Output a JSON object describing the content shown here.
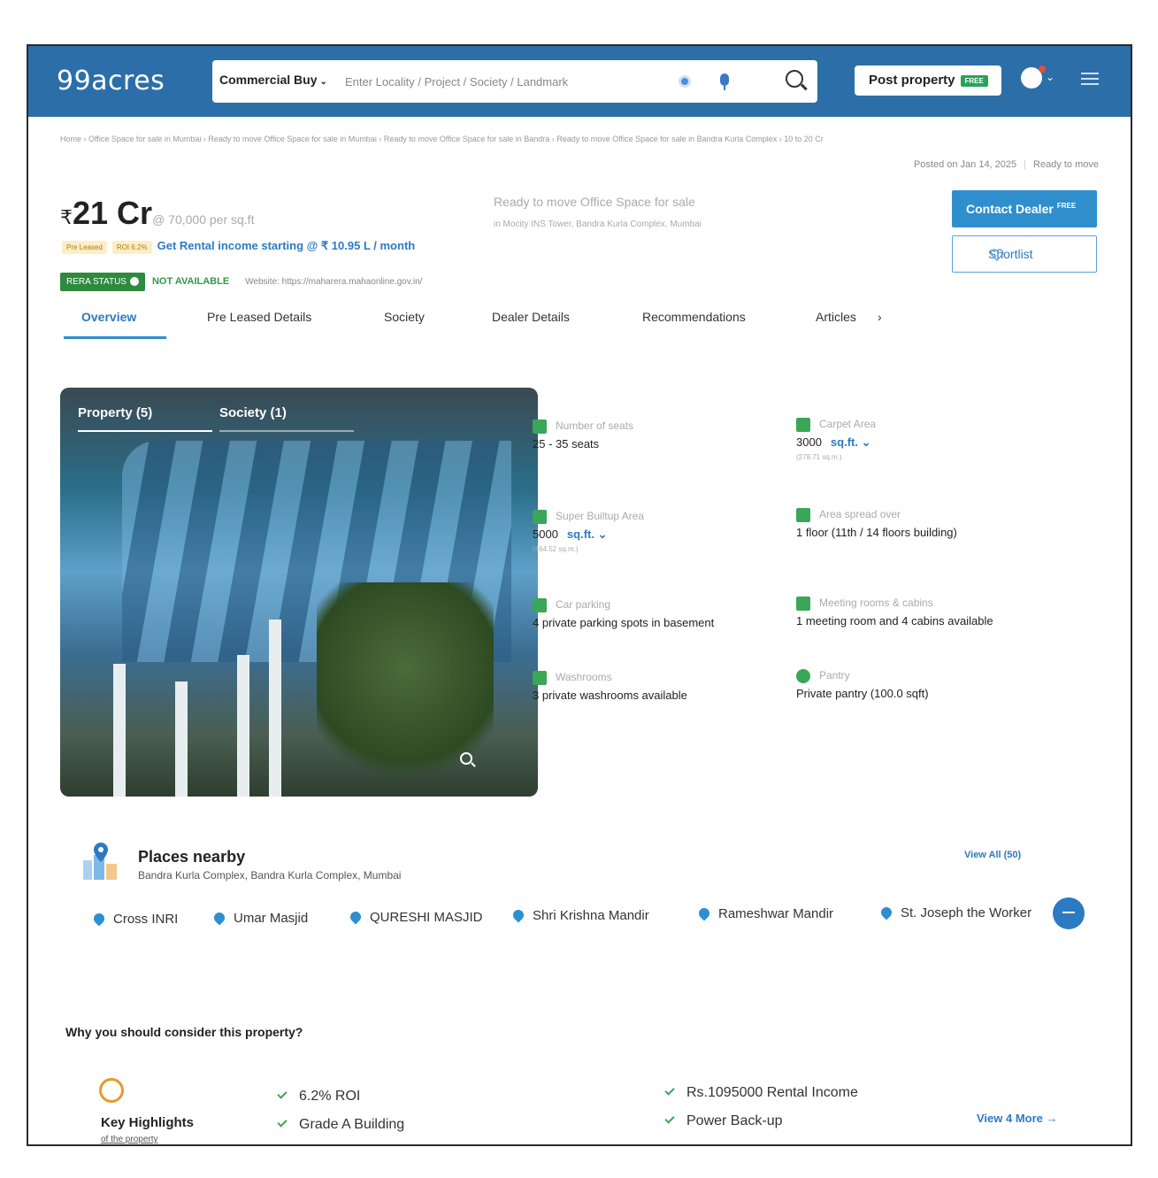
{
  "header": {
    "logo": "99acres",
    "search_type": "Commercial Buy",
    "search_placeholder": "Enter Locality / Project / Society / Landmark",
    "post_label": "Post property",
    "post_badge": "FREE"
  },
  "breadcrumb": "Home › Office Space for sale in Mumbai › Ready to move Office Space for sale in Mumbai › Ready to move Office Space for sale in Bandra › Ready to move Office Space for sale in Bandra Kurla Complex › 10 to 20 Cr",
  "posted": {
    "date": "Posted on Jan 14, 2025",
    "status": "Ready to move"
  },
  "listing": {
    "rupee": "₹",
    "price": "21 Cr",
    "per_sqft": "@ 70,000 per sq.ft",
    "title": "Ready to move Office Space for sale",
    "address": "in Mocity INS Tower, Bandra Kurla Complex, Mumbai",
    "badge_preleased": "Pre Leased",
    "badge_roi": "ROI 6.2%",
    "rental_text": "Get Rental income starting @ ₹ 10.95 L / month",
    "rera_label": "RERA STATUS",
    "rera_status": "NOT AVAILABLE",
    "website": "Website: https://maharera.mahaonline.gov.in/"
  },
  "actions": {
    "contact": "Contact Dealer",
    "contact_badge": "FREE",
    "shortlist": "Shortlist"
  },
  "tabs": [
    "Overview",
    "Pre Leased Details",
    "Society",
    "Dealer Details",
    "Recommendations",
    "Articles"
  ],
  "tabs_more": "›",
  "gallery": {
    "tab1": "Property (5)",
    "tab2": "Society (1)"
  },
  "features": [
    {
      "label": "Number of seats",
      "value": "25 - 35 seats",
      "unit": "",
      "sub": ""
    },
    {
      "label": "Carpet Area",
      "value": "3000",
      "unit": "sq.ft. ⌄",
      "sub": "(278.71 sq.m.)"
    },
    {
      "label": "Super Builtup Area",
      "value": "5000",
      "unit": "sq.ft. ⌄",
      "sub": "(464.52 sq.m.)"
    },
    {
      "label": "Area spread over",
      "value": "1 floor (11th / 14 floors building)",
      "unit": "",
      "sub": ""
    },
    {
      "label": "Car parking",
      "value": "4 private parking spots in basement",
      "unit": "",
      "sub": ""
    },
    {
      "label": "Meeting rooms & cabins",
      "value": "1 meeting room and 4 cabins available",
      "unit": "",
      "sub": ""
    },
    {
      "label": "Washrooms",
      "value": "3 private washrooms available",
      "unit": "",
      "sub": ""
    },
    {
      "label": "Pantry",
      "value": "Private pantry (100.0 sqft)",
      "unit": "",
      "sub": ""
    }
  ],
  "nearby": {
    "title": "Places nearby",
    "address": "Bandra Kurla Complex, Bandra Kurla Complex, Mumbai",
    "view_all": "View All (50)",
    "places": [
      "Cross INRI",
      "Umar Masjid",
      "QURESHI MASJID",
      "Shri Krishna Mandir",
      "Rameshwar Mandir",
      "St. Joseph the Worker"
    ]
  },
  "consider": {
    "title": "Why you should consider this property?",
    "kh_title": "Key Highlights",
    "kh_sub": "of the property",
    "highlights": [
      "6.2% ROI",
      "Grade A Building",
      "Rs.1095000 Rental Income",
      "Power Back-up"
    ],
    "view_more": "View 4 More →"
  },
  "colors": {
    "header": "#2c6ea8",
    "accent": "#2c7ac2",
    "green": "#2e8b3e"
  }
}
